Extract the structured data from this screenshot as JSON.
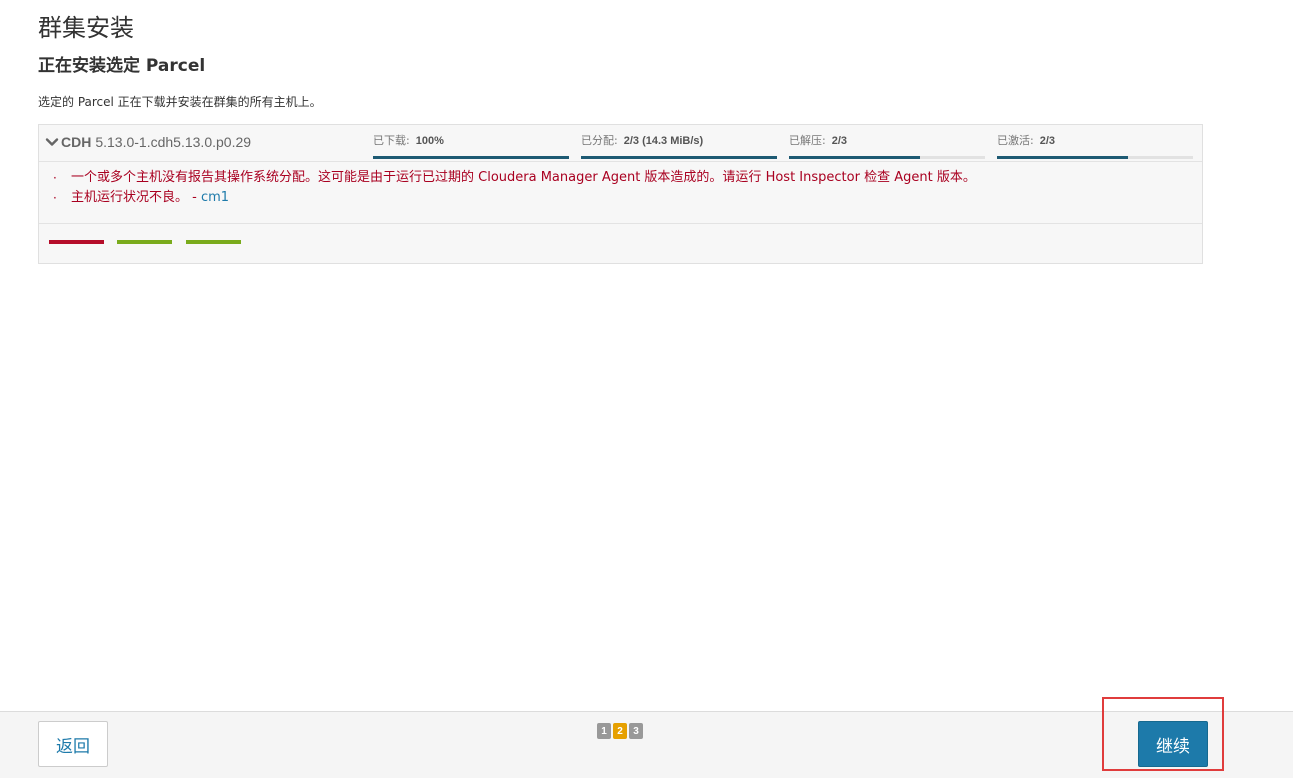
{
  "header": {
    "title": "群集安装",
    "subtitle": "正在安装选定 Parcel",
    "description": "选定的 Parcel 正在下载并安装在群集的所有主机上。"
  },
  "parcel": {
    "name": "CDH",
    "version": "5.13.0-1.cdh5.13.0.p0.29",
    "stats": [
      {
        "label": "已下载:",
        "value": "100%",
        "fraction": 1.0
      },
      {
        "label": "已分配:",
        "value": "2/3 (14.3 MiB/s)",
        "fraction": 1.0
      },
      {
        "label": "已解压:",
        "value": "2/3",
        "fraction": 0.67
      },
      {
        "label": "已激活:",
        "value": "2/3",
        "fraction": 0.67
      }
    ],
    "messages": [
      {
        "bullet": "·",
        "text": "一个或多个主机没有报告其操作系统分配。这可能是由于运行已过期的 Cloudera Manager Agent 版本造成的。请运行 Host Inspector 检查 Agent 版本。",
        "host": ""
      },
      {
        "bullet": "·",
        "text": "主机运行状况不良。 -",
        "host": "cm1"
      }
    ],
    "host_status_colors": [
      "#b50d2a",
      "#7aab1c",
      "#7aab1c"
    ]
  },
  "footer": {
    "back_label": "返回",
    "continue_label": "继续",
    "steps": [
      {
        "label": "1",
        "color": "#999999"
      },
      {
        "label": "2",
        "color": "#e6a000"
      },
      {
        "label": "3",
        "color": "#999999"
      }
    ]
  },
  "colors": {
    "accent": "#1d7aaa",
    "error": "#a90020",
    "progress": "#1d5a73",
    "highlight": "#e03c3c"
  }
}
